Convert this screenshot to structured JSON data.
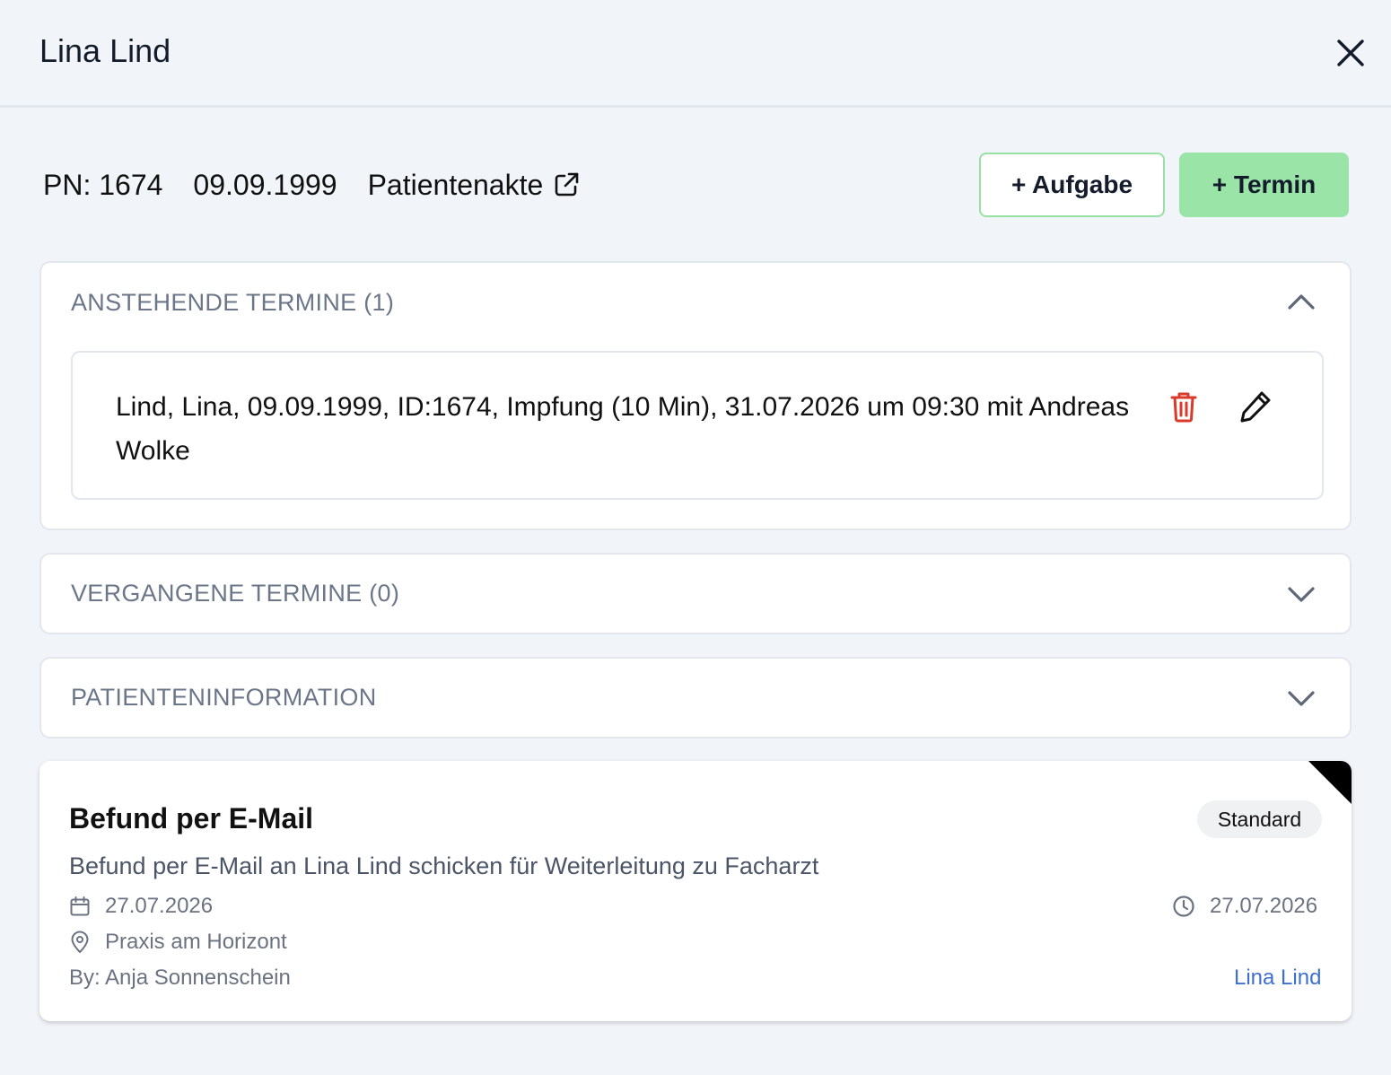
{
  "header": {
    "title": "Lina Lind",
    "close_icon": "close-icon"
  },
  "meta": {
    "pn": "PN: 1674",
    "birthdate": "09.09.1999",
    "record_link": "Patientenakte",
    "record_icon": "external-link-icon"
  },
  "actions": {
    "add_task": "+ Aufgabe",
    "add_appointment": "+ Termin"
  },
  "colors": {
    "accent_green": "#9ae4a8",
    "delete_red": "#d93a2b",
    "link_blue": "#3e6fd3",
    "background": "#f1f4f9"
  },
  "sections": {
    "upcoming": {
      "title": "ANSTEHENDE TERMINE (1)",
      "expanded": true,
      "appointments": [
        {
          "text": "Lind, Lina, 09.09.1999, ID:1674, Impfung (10 Min), 31.07.2026 um 09:30 mit Andreas Wolke",
          "delete_icon": "trash-icon",
          "edit_icon": "pencil-icon"
        }
      ]
    },
    "past": {
      "title": "VERGANGENE TERMINE (0)",
      "expanded": false
    },
    "patient_info": {
      "title": "PATIENTENINFORMATION",
      "expanded": false
    }
  },
  "task": {
    "title": "Befund per E-Mail",
    "badge": "Standard",
    "description": "Befund per E-Mail an Lina Lind schicken für Weiterleitung zu Facharzt",
    "date": "27.07.2026",
    "due_date": "27.07.2026",
    "location": "Praxis am Horizont",
    "created_by": "By: Anja Sonnenschein",
    "assignee": "Lina Lind"
  }
}
